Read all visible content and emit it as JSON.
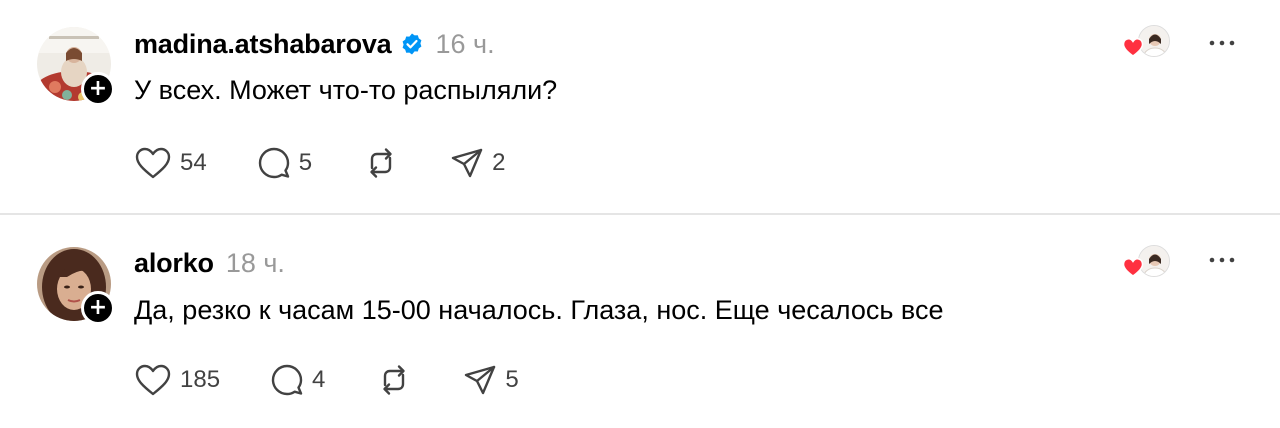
{
  "posts": [
    {
      "username": "madina.atshabarova",
      "verified": true,
      "time": "16 ч.",
      "text": "У всех. Может что-то распыляли?",
      "likes": "54",
      "replies": "5",
      "shares": "2",
      "follow_badge": "+"
    },
    {
      "username": "alorko",
      "verified": false,
      "time": "18 ч.",
      "text": "Да, резко к часам 15-00 началось. Глаза, нос. Еще чесалось все",
      "likes": "185",
      "replies": "4",
      "shares": "5",
      "follow_badge": "+"
    }
  ],
  "icons": {
    "like": "heart-outline-icon",
    "reply": "speech-bubble-icon",
    "repost": "repost-arrows-icon",
    "share": "paper-plane-icon",
    "more": "more-dots-icon",
    "verified": "verified-badge-icon",
    "liked_by": "red-heart-icon"
  },
  "colors": {
    "verified": "#0095f6",
    "liked_heart": "#ff3040",
    "timestamp": "#999999",
    "action_icon": "#424242",
    "divider": "#e5e5e5"
  }
}
